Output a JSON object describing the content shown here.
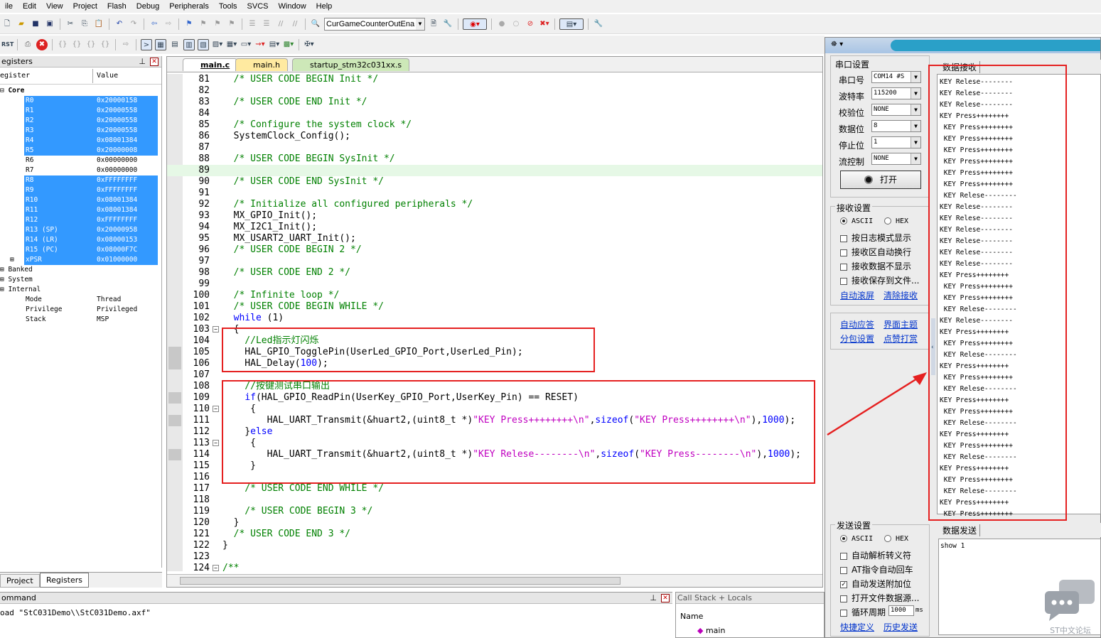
{
  "menu": [
    "ile",
    "Edit",
    "View",
    "Project",
    "Flash",
    "Debug",
    "Peripherals",
    "Tools",
    "SVCS",
    "Window",
    "Help"
  ],
  "toolbar": {
    "target_combo": "CurGameCounterOutEna"
  },
  "registers": {
    "title": "egisters",
    "col_register": "egister",
    "col_value": "Value",
    "core_label": "Core",
    "rows": [
      {
        "name": "R0",
        "value": "0x20000158",
        "sel": true
      },
      {
        "name": "R1",
        "value": "0x20000558",
        "sel": true
      },
      {
        "name": "R2",
        "value": "0x20000558",
        "sel": true
      },
      {
        "name": "R3",
        "value": "0x20000558",
        "sel": true
      },
      {
        "name": "R4",
        "value": "0x08001384",
        "sel": true
      },
      {
        "name": "R5",
        "value": "0x20000008",
        "sel": true
      },
      {
        "name": "R6",
        "value": "0x00000000",
        "sel": false
      },
      {
        "name": "R7",
        "value": "0x00000000",
        "sel": false
      },
      {
        "name": "R8",
        "value": "0xFFFFFFFF",
        "sel": true
      },
      {
        "name": "R9",
        "value": "0xFFFFFFFF",
        "sel": true
      },
      {
        "name": "R10",
        "value": "0x08001384",
        "sel": true
      },
      {
        "name": "R11",
        "value": "0x08001384",
        "sel": true
      },
      {
        "name": "R12",
        "value": "0xFFFFFFFF",
        "sel": true
      },
      {
        "name": "R13 (SP)",
        "value": "0x20000958",
        "sel": true
      },
      {
        "name": "R14 (LR)",
        "value": "0x08000153",
        "sel": true
      },
      {
        "name": "R15 (PC)",
        "value": "0x08000F7C",
        "sel": true
      },
      {
        "name": "xPSR",
        "value": "0x01000000",
        "sel": true
      }
    ],
    "groups": [
      "Banked",
      "System",
      "Internal"
    ],
    "internal": [
      {
        "name": "Mode",
        "value": "Thread"
      },
      {
        "name": "Privilege",
        "value": "Privileged"
      },
      {
        "name": "Stack",
        "value": "MSP"
      }
    ],
    "tab_project": "Project",
    "tab_registers": "Registers"
  },
  "editor": {
    "tabs": [
      "main.c",
      "main.h",
      "startup_stm32c031xx.s"
    ],
    "lines": [
      {
        "n": "81",
        "h": "<span class='cm'>  /* USER CODE BEGIN Init */</span>"
      },
      {
        "n": "82",
        "h": ""
      },
      {
        "n": "83",
        "h": "<span class='cm'>  /* USER CODE END Init */</span>"
      },
      {
        "n": "84",
        "h": ""
      },
      {
        "n": "85",
        "h": "<span class='cm'>  /* Configure the system clock */</span>"
      },
      {
        "n": "86",
        "h": "  SystemClock_Config();"
      },
      {
        "n": "87",
        "h": ""
      },
      {
        "n": "88",
        "h": "<span class='cm'>  /* USER CODE BEGIN SysInit */</span>"
      },
      {
        "n": "89",
        "h": ""
      },
      {
        "n": "90",
        "h": "<span class='cm'>  /* USER CODE END SysInit */</span>"
      },
      {
        "n": "91",
        "h": ""
      },
      {
        "n": "92",
        "h": "<span class='cm'>  /* Initialize all configured peripherals */</span>"
      },
      {
        "n": "93",
        "h": "  MX_GPIO_Init();"
      },
      {
        "n": "94",
        "h": "  MX_I2C1_Init();"
      },
      {
        "n": "95",
        "h": "  MX_USART2_UART_Init();"
      },
      {
        "n": "96",
        "h": "<span class='cm'>  /* USER CODE BEGIN 2 */</span>"
      },
      {
        "n": "97",
        "h": ""
      },
      {
        "n": "98",
        "h": "<span class='cm'>  /* USER CODE END 2 */</span>"
      },
      {
        "n": "99",
        "h": ""
      },
      {
        "n": "100",
        "h": "<span class='cm'>  /* Infinite loop */</span>"
      },
      {
        "n": "101",
        "h": "<span class='cm'>  /* USER CODE BEGIN WHILE */</span>"
      },
      {
        "n": "102",
        "h": "  <span class='kw'>while</span> (1)"
      },
      {
        "n": "103",
        "h": "  {"
      },
      {
        "n": "104",
        "h": "<span class='cm'>    //Led指示灯闪烁</span>"
      },
      {
        "n": "105",
        "h": "    HAL_GPIO_TogglePin(UserLed_GPIO_Port,UserLed_Pin);"
      },
      {
        "n": "106",
        "h": "    HAL_Delay(<span class='nm'>100</span>);"
      },
      {
        "n": "107",
        "h": ""
      },
      {
        "n": "108",
        "h": "<span class='cm'>    //按键测试串口输出</span>"
      },
      {
        "n": "109",
        "h": "    <span class='kw'>if</span>(HAL_GPIO_ReadPin(UserKey_GPIO_Port,UserKey_Pin) == RESET)"
      },
      {
        "n": "110",
        "h": "     {"
      },
      {
        "n": "111",
        "h": "        HAL_UART_Transmit(&amp;huart2,(uint8_t *)<span class='st'>\"KEY Press++++++++\\n\"</span>,<span class='kw'>sizeof</span>(<span class='st'>\"KEY Press++++++++\\n\"</span>),<span class='nm'>1000</span>);"
      },
      {
        "n": "112",
        "h": "    }<span class='kw'>else</span>"
      },
      {
        "n": "113",
        "h": "     {"
      },
      {
        "n": "114",
        "h": "        HAL_UART_Transmit(&amp;huart2,(uint8_t *)<span class='st'>\"KEY Relese--------\\n\"</span>,<span class='kw'>sizeof</span>(<span class='st'>\"KEY Press--------\\n\"</span>),<span class='nm'>1000</span>);"
      },
      {
        "n": "115",
        "h": "     }"
      },
      {
        "n": "116",
        "h": ""
      },
      {
        "n": "117",
        "h": "<span class='cm'>    /* USER CODE END WHILE */</span>"
      },
      {
        "n": "118",
        "h": ""
      },
      {
        "n": "119",
        "h": "<span class='cm'>    /* USER CODE BEGIN 3 */</span>"
      },
      {
        "n": "120",
        "h": "  }"
      },
      {
        "n": "121",
        "h": "<span class='cm'>  /* USER CODE END 3 */</span>"
      },
      {
        "n": "122",
        "h": "}"
      },
      {
        "n": "123",
        "h": ""
      },
      {
        "n": "124",
        "h": "<span class='cm'>/**</span>"
      }
    ]
  },
  "command": {
    "title": "ommand",
    "text": "oad \"StC031Demo\\\\StC031Demo.axf\""
  },
  "callstack": {
    "title": "Call Stack + Locals",
    "col_name": "Name",
    "item": "main"
  },
  "serial": {
    "port_settings": "串口设置",
    "port_label": "串口号",
    "port_value": "COM14 #S",
    "baud_label": "波特率",
    "baud_value": "115200",
    "parity_label": "校验位",
    "parity_value": "NONE",
    "data_label": "数据位",
    "data_value": "8",
    "stop_label": "停止位",
    "stop_value": "1",
    "flow_label": "流控制",
    "flow_value": "NONE",
    "open_button": "打开",
    "rx_settings": "接收设置",
    "ascii": "ASCII",
    "hex": "HEX",
    "rx_opts": [
      "按日志模式显示",
      "接收区自动换行",
      "接收数据不显示",
      "接收保存到文件..."
    ],
    "auto_scroll": "自动滚屏",
    "clear_rx": "清除接收",
    "auto_reply": "自动应答",
    "theme": "界面主题",
    "packet": "分包设置",
    "donate": "点赞打赏",
    "tx_settings": "发送设置",
    "tx_opts": [
      "自动解析转义符",
      "AT指令自动回车",
      "自动发送附加位",
      "打开文件数据源...",
      "循环周期"
    ],
    "period_value": "1000",
    "period_unit": "ms",
    "shortcut": "快捷定义",
    "history": "历史发送",
    "rx_tab": "数据接收",
    "tx_tab": "数据发送",
    "tx_text": "show 1",
    "rx_lines": [
      "KEY Relese--------",
      "KEY Relese--------",
      "KEY Relese--------",
      "KEY Press++++++++",
      " KEY Press++++++++",
      " KEY Press++++++++",
      " KEY Press++++++++",
      " KEY Press++++++++",
      " KEY Press++++++++",
      " KEY Press++++++++",
      " KEY Relese--------",
      "KEY Relese--------",
      "KEY Relese--------",
      "KEY Relese--------",
      "KEY Relese--------",
      "KEY Relese--------",
      "KEY Relese--------",
      "KEY Press++++++++",
      " KEY Press++++++++",
      " KEY Press++++++++",
      " KEY Relese--------",
      "KEY Relese--------",
      "KEY Press++++++++",
      " KEY Press++++++++",
      " KEY Relese--------",
      "KEY Press++++++++",
      " KEY Press++++++++",
      " KEY Relese--------",
      "KEY Press++++++++",
      " KEY Press++++++++",
      " KEY Relese--------",
      "KEY Press++++++++",
      " KEY Press++++++++",
      " KEY Relese--------",
      "KEY Press++++++++",
      " KEY Press++++++++",
      " KEY Relese--------",
      "KEY Press++++++++",
      " KEY Press++++++++"
    ],
    "watermark": "ST中文论坛"
  }
}
